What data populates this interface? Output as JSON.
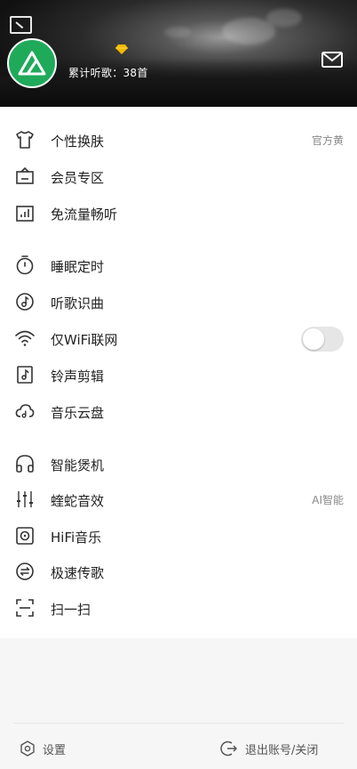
{
  "header": {
    "listen_count": "累计听歌：38首"
  },
  "menu": {
    "skin": {
      "label": "个性换肤",
      "value": "官方黄"
    },
    "vip": {
      "label": "会员专区"
    },
    "free_data": {
      "label": "免流量畅听"
    },
    "sleep_timer": {
      "label": "睡眠定时"
    },
    "song_recognition": {
      "label": "听歌识曲"
    },
    "wifi_only": {
      "label": "仅WiFi联网",
      "enabled": false
    },
    "ringtone": {
      "label": "铃声剪辑"
    },
    "cloud_disk": {
      "label": "音乐云盘"
    },
    "smart_burn": {
      "label": "智能煲机"
    },
    "viper_sound": {
      "label": "蝰蛇音效",
      "value": "AI智能"
    },
    "hifi": {
      "label": "HiFi音乐"
    },
    "fast_transfer": {
      "label": "极速传歌"
    },
    "scan": {
      "label": "扫一扫"
    }
  },
  "footer": {
    "settings_label": "设置",
    "logout_label": "退出账号/关闭"
  },
  "colors": {
    "avatar_bg": "#1faa5a",
    "text_primary": "#222222",
    "text_secondary": "#888888"
  }
}
